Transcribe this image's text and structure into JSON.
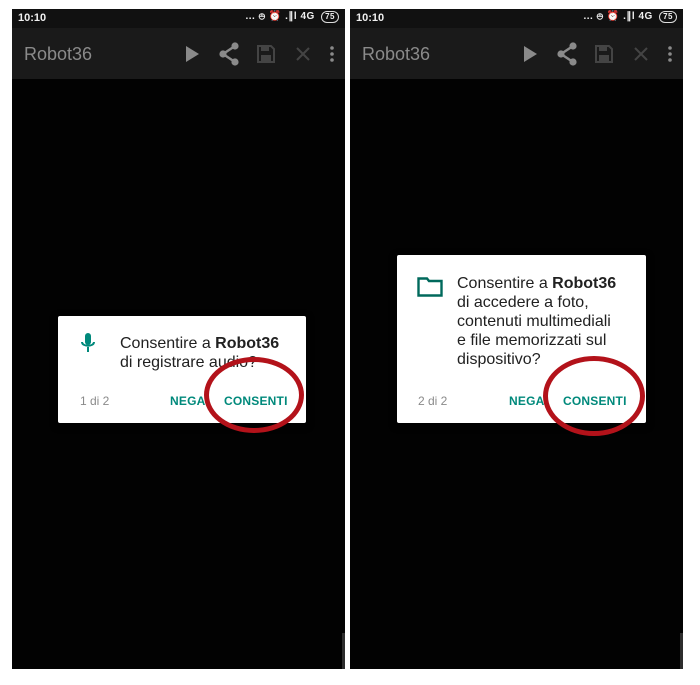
{
  "panels": [
    {
      "status": {
        "time": "10:10",
        "indicators": "... ⦺ ⏰ .∥l 4G",
        "battery": "75"
      },
      "app": {
        "title": "Robot36",
        "icons": [
          "play-icon",
          "share-icon",
          "save-icon",
          "close-icon",
          "overflow-menu-icon"
        ]
      },
      "dialog": {
        "icon": "microphone-icon",
        "prefix": "Consentire a ",
        "app_name": "Robot36",
        "text": "di registrare audio?",
        "counter": "1 di 2",
        "deny": "NEGA",
        "allow": "CONSENTI"
      }
    },
    {
      "status": {
        "time": "10:10",
        "indicators": "... ⦺ ⏰ .∥l 4G",
        "battery": "75"
      },
      "app": {
        "title": "Robot36",
        "icons": [
          "play-icon",
          "share-icon",
          "save-icon",
          "close-icon",
          "overflow-menu-icon"
        ]
      },
      "dialog": {
        "icon": "folder-icon",
        "prefix": "Consentire a ",
        "app_name": "Robot36",
        "text_lines": [
          "di accedere a foto,",
          "contenuti multimediali",
          "e file memorizzati sul",
          "dispositivo?"
        ],
        "counter": "2 di 2",
        "deny": "NEGA",
        "allow": "CONSENTI"
      }
    }
  ],
  "colors": {
    "accent": "#00897b",
    "highlight_ring": "#b3121a",
    "app_bar": "#1a1a1a",
    "icon_gray": "#8a8a8a"
  }
}
